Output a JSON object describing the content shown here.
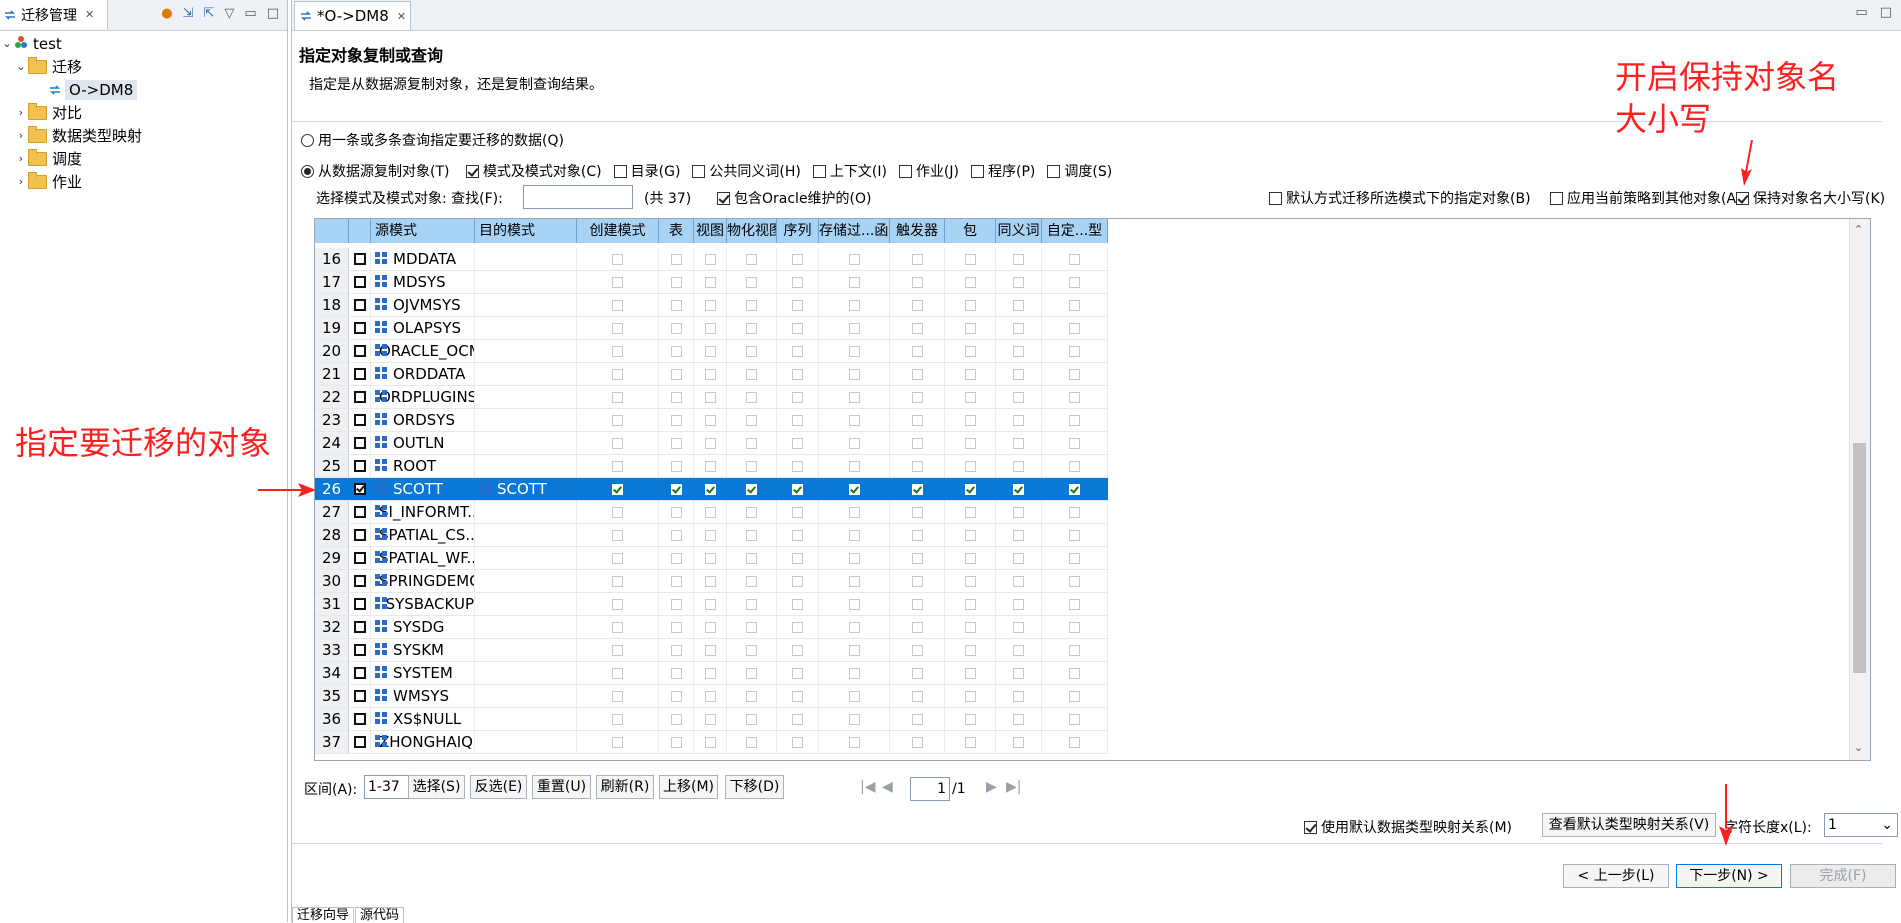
{
  "left_pane": {
    "tab_title": "迁移管理",
    "tree": {
      "project": "test",
      "migration_folder": "迁移",
      "migration_item": "O->DM8",
      "compare": "对比",
      "type_mapping": "数据类型映射",
      "schedule": "调度",
      "job": "作业"
    }
  },
  "editor": {
    "tab_title": "*O->DM8",
    "wizard_title": "指定对象复制或查询",
    "wizard_desc": "指定是从数据源复制对象，还是复制查询结果。",
    "radio_query": "用一条或多条查询指定要迁移的数据(Q)",
    "radio_copy": "从数据源复制对象(T)",
    "options": [
      {
        "label": "模式及模式对象(C)",
        "checked": true
      },
      {
        "label": "目录(G)",
        "checked": false
      },
      {
        "label": "公共同义词(H)",
        "checked": false
      },
      {
        "label": "上下文(I)",
        "checked": false
      },
      {
        "label": "作业(J)",
        "checked": false
      },
      {
        "label": "程序(P)",
        "checked": false
      },
      {
        "label": "调度(S)",
        "checked": false
      }
    ],
    "filter": {
      "label": "选择模式及模式对象:",
      "find_label": "查找(F):",
      "count": "(共 37)",
      "include_oracle": "包含Oracle维护的(O)",
      "default_way": "默认方式迁移所选模式下的指定对象(B)",
      "apply_policy": "应用当前策略到其他对象(A)",
      "keep_case": "保持对象名大小写(K)"
    },
    "table": {
      "headers": [
        "源模式",
        "目的模式",
        "创建模式",
        "表",
        "视图",
        "物化视图",
        "序列",
        "存储过...函数",
        "触发器",
        "包",
        "同义词",
        "自定...型"
      ],
      "rows": [
        {
          "no": "16",
          "schema": "MDDATA",
          "target": "",
          "checked": false
        },
        {
          "no": "17",
          "schema": "MDSYS",
          "target": "",
          "checked": false
        },
        {
          "no": "18",
          "schema": "OJVMSYS",
          "target": "",
          "checked": false
        },
        {
          "no": "19",
          "schema": "OLAPSYS",
          "target": "",
          "checked": false
        },
        {
          "no": "20",
          "schema": "ORACLE_OCM",
          "target": "",
          "checked": false
        },
        {
          "no": "21",
          "schema": "ORDDATA",
          "target": "",
          "checked": false
        },
        {
          "no": "22",
          "schema": "ORDPLUGINS",
          "target": "",
          "checked": false
        },
        {
          "no": "23",
          "schema": "ORDSYS",
          "target": "",
          "checked": false
        },
        {
          "no": "24",
          "schema": "OUTLN",
          "target": "",
          "checked": false
        },
        {
          "no": "25",
          "schema": "ROOT",
          "target": "",
          "checked": false
        },
        {
          "no": "26",
          "schema": "SCOTT",
          "target": "SCOTT",
          "checked": true
        },
        {
          "no": "27",
          "schema": "SI_INFORMT...",
          "target": "",
          "checked": false
        },
        {
          "no": "28",
          "schema": "SPATIAL_CS...",
          "target": "",
          "checked": false
        },
        {
          "no": "29",
          "schema": "SPATIAL_WF...",
          "target": "",
          "checked": false
        },
        {
          "no": "30",
          "schema": "SPRINGDEMO",
          "target": "",
          "checked": false
        },
        {
          "no": "31",
          "schema": "SYSBACKUP",
          "target": "",
          "checked": false
        },
        {
          "no": "32",
          "schema": "SYSDG",
          "target": "",
          "checked": false
        },
        {
          "no": "33",
          "schema": "SYSKM",
          "target": "",
          "checked": false
        },
        {
          "no": "34",
          "schema": "SYSTEM",
          "target": "",
          "checked": false
        },
        {
          "no": "35",
          "schema": "WMSYS",
          "target": "",
          "checked": false
        },
        {
          "no": "36",
          "schema": "XS$NULL",
          "target": "",
          "checked": false
        },
        {
          "no": "37",
          "schema": "ZHONGHAIQI.",
          "target": "",
          "checked": false
        }
      ]
    },
    "range": {
      "label": "区间(A):",
      "value": "1-37",
      "buttons": [
        "选择(S)",
        "反选(E)",
        "重置(U)",
        "刷新(R)",
        "上移(M)",
        "下移(D)"
      ],
      "page_value": "1",
      "page_total": "/1"
    },
    "mapping": {
      "use_default": "使用默认数据类型映射关系(M)",
      "view_default": "查看默认类型映射关系(V)",
      "char_len_label": "字符长度x(L):",
      "char_len_value": "1"
    },
    "nav": {
      "prev": "< 上一步(L)",
      "next": "下一步(N) >",
      "finish": "完成(F)"
    },
    "bottom_tabs": [
      "迁移向导",
      "源代码"
    ]
  },
  "annotations": {
    "left": "指定要迁移的对象",
    "right": "开启保持对象名\n大小写"
  },
  "colors": {
    "selection": "#0a78d7",
    "header": "#a8d3f5",
    "annotation": "#ff1f1f"
  }
}
